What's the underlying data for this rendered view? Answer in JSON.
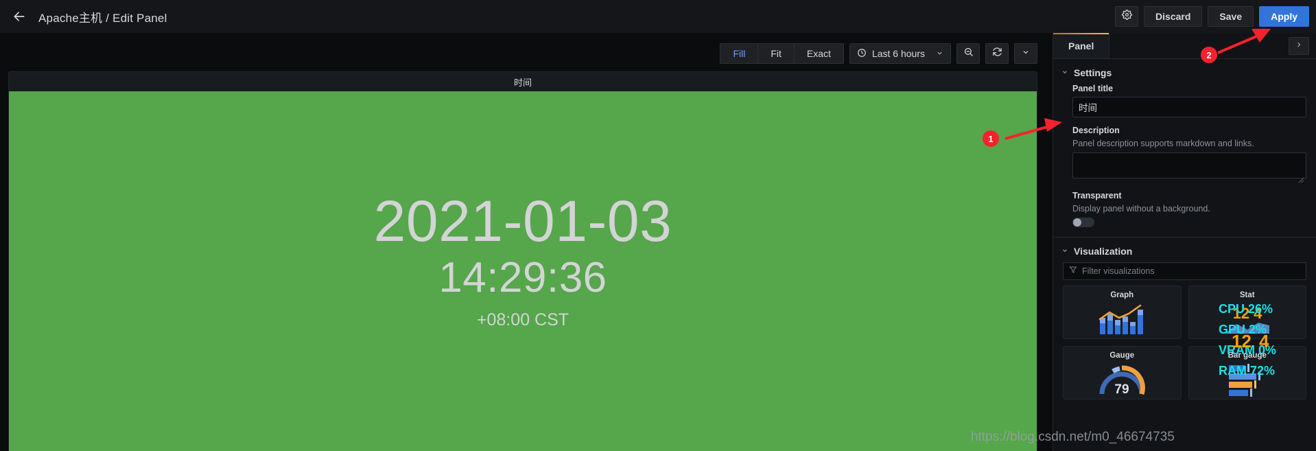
{
  "navbar": {
    "back_icon": "arrow-left-icon",
    "title": "Apache主机 / Edit Panel",
    "gear_icon": "gear-icon",
    "discard_label": "Discard",
    "save_label": "Save",
    "apply_label": "Apply"
  },
  "toolbar": {
    "segments": [
      {
        "label": "Fill",
        "active": true
      },
      {
        "label": "Fit",
        "active": false
      },
      {
        "label": "Exact",
        "active": false
      }
    ],
    "time_range": "Last 6 hours",
    "clock_icon": "clock-icon",
    "zoom_out_icon": "zoom-out-icon",
    "refresh_icon": "refresh-icon",
    "refresh_caret_icon": "chevron-down-icon"
  },
  "panel": {
    "title": "时间",
    "background_color": "#56A64B",
    "text_color": "#d3d4d6",
    "clock": {
      "date": "2021-01-03",
      "time": "14:29:36",
      "timezone": "+08:00 CST"
    }
  },
  "sidebar": {
    "tab_label": "Panel",
    "expand_icon": "chevron-right-icon",
    "settings": {
      "section_title": "Settings",
      "caret_icon": "chevron-down-icon",
      "panel_title_label": "Panel title",
      "panel_title_value": "时间",
      "description_label": "Description",
      "description_help": "Panel description supports markdown and links.",
      "description_value": "",
      "transparent_label": "Transparent",
      "transparent_help": "Display panel without a background.",
      "transparent_on": false
    },
    "visualization": {
      "section_title": "Visualization",
      "caret_icon": "chevron-down-icon",
      "filter_icon": "filter-icon",
      "filter_placeholder": "Filter visualizations",
      "cards": [
        {
          "name": "Graph",
          "icon": "graph-viz-icon"
        },
        {
          "name": "Stat",
          "icon": "stat-viz-icon"
        },
        {
          "name": "Gauge",
          "icon": "gauge-viz-icon",
          "value": "79"
        },
        {
          "name": "Bar gauge",
          "icon": "bar-gauge-viz-icon"
        }
      ]
    }
  },
  "annotations": {
    "marker_one": "1",
    "marker_two": "2"
  },
  "overlay": {
    "watermark": "https://blog.csdn.net/m0_46674735",
    "osd": {
      "cpu": "CPU  26%",
      "gpu": "GPU  2%",
      "vram": "VRAM  0%",
      "ram": "RAM  72%",
      "fps": "12",
      "fps2": "4"
    }
  }
}
